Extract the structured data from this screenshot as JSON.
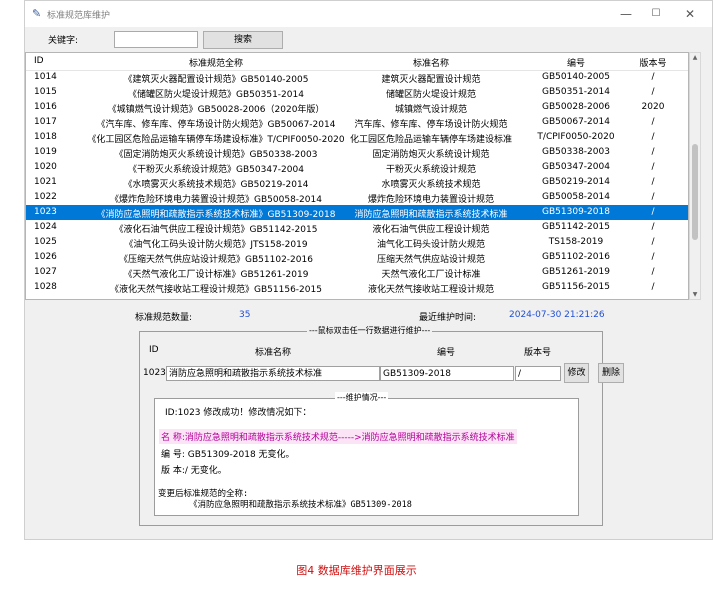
{
  "window": {
    "title": "标准规范库维护",
    "min_glyph": "—",
    "max_glyph": "☐",
    "close_glyph": "✕",
    "app_icon_glyph": "✎"
  },
  "search": {
    "label": "关键字:",
    "value": "",
    "button_label": "搜索"
  },
  "table": {
    "headers": [
      "ID",
      "标准规范全称",
      "标准名称",
      "编号",
      "版本号"
    ],
    "rows": [
      {
        "id": "1014",
        "full": "《建筑灭火器配置设计规范》GB50140-2005",
        "name": "建筑灭火器配置设计规范",
        "code": "GB50140-2005",
        "ver": "/"
      },
      {
        "id": "1015",
        "full": "《储罐区防火堤设计规范》GB50351-2014",
        "name": "储罐区防火堤设计规范",
        "code": "GB50351-2014",
        "ver": "/"
      },
      {
        "id": "1016",
        "full": "《城镇燃气设计规范》GB50028-2006（2020年版）",
        "name": "城镇燃气设计规范",
        "code": "GB50028-2006",
        "ver": "2020"
      },
      {
        "id": "1017",
        "full": "《汽车库、修车库、停车场设计防火规范》GB50067-2014",
        "name": "汽车库、修车库、停车场设计防火规范",
        "code": "GB50067-2014",
        "ver": "/"
      },
      {
        "id": "1018",
        "full": "《化工园区危险品运输车辆停车场建设标准》T/CPIF0050-2020",
        "name": "化工园区危险品运输车辆停车场建设标准",
        "code": "T/CPIF0050-2020",
        "ver": "/"
      },
      {
        "id": "1019",
        "full": "《固定消防炮灭火系统设计规范》GB50338-2003",
        "name": "固定消防炮灭火系统设计规范",
        "code": "GB50338-2003",
        "ver": "/"
      },
      {
        "id": "1020",
        "full": "《干粉灭火系统设计规范》GB50347-2004",
        "name": "干粉灭火系统设计规范",
        "code": "GB50347-2004",
        "ver": "/"
      },
      {
        "id": "1021",
        "full": "《水喷雾灭火系统技术规范》GB50219-2014",
        "name": "水喷雾灭火系统技术规范",
        "code": "GB50219-2014",
        "ver": "/"
      },
      {
        "id": "1022",
        "full": "《爆炸危险环境电力装置设计规范》GB50058-2014",
        "name": "爆炸危险环境电力装置设计规范",
        "code": "GB50058-2014",
        "ver": "/"
      },
      {
        "id": "1023",
        "full": "《消防应急照明和疏散指示系统技术标准》GB51309-2018",
        "name": "消防应急照明和疏散指示系统技术标准",
        "code": "GB51309-2018",
        "ver": "/"
      },
      {
        "id": "1024",
        "full": "《液化石油气供应工程设计规范》GB51142-2015",
        "name": "液化石油气供应工程设计规范",
        "code": "GB51142-2015",
        "ver": "/"
      },
      {
        "id": "1025",
        "full": "《油气化工码头设计防火规范》JTS158-2019",
        "name": "油气化工码头设计防火规范",
        "code": "TS158-2019",
        "ver": "/"
      },
      {
        "id": "1026",
        "full": "《压缩天然气供应站设计规范》GB51102-2016",
        "name": "压缩天然气供应站设计规范",
        "code": "GB51102-2016",
        "ver": "/"
      },
      {
        "id": "1027",
        "full": "《天然气液化工厂设计标准》GB51261-2019",
        "name": "天然气液化工厂设计标准",
        "code": "GB51261-2019",
        "ver": "/"
      },
      {
        "id": "1028",
        "full": "《液化天然气接收站工程设计规范》GB51156-2015",
        "name": "液化天然气接收站工程设计规范",
        "code": "GB51156-2015",
        "ver": "/"
      }
    ],
    "selected_id": "1023",
    "scroll_position": 0.62,
    "scroll_visible_fraction": 0.43,
    "scroll_up_glyph": "▲",
    "scroll_down_glyph": "▼"
  },
  "status": {
    "count_label": "标准规范数量:",
    "count_value": "35",
    "time_label": "最近维护时间:",
    "time_value": "2024-07-30 21:21:26"
  },
  "edit": {
    "group_title": "---鼠标双击任一行数据进行维护---",
    "headers": {
      "id": "ID",
      "name": "标准名称",
      "code": "编号",
      "ver": "版本号"
    },
    "id": "1023",
    "name": "消防应急照明和疏散指示系统技术标准",
    "code": "GB51309-2018",
    "ver": "/",
    "modify_label": "修改",
    "delete_label": "删除"
  },
  "log": {
    "group_title": "---维护情况---",
    "line1": "ID:1023  修改成功！修改情况如下：",
    "line2": "名 称:消防应急照明和疏散指示系统技术规范----->消防应急照明和疏散指示系统技术标准",
    "line3": "编 号: GB51309-2018 无变化。",
    "line4": "版 本:/ 无变化。",
    "line5": "变更后标准规范的全称:",
    "line6": "《消防应急照明和疏散指示系统技术标准》GB51309-2018"
  },
  "caption": "图4  数据库维护界面展示",
  "colors": {
    "selection": "#0078d7",
    "value_blue": "#1f4fd6",
    "log_highlight": "#b5009a",
    "caption_red": "#d01010"
  }
}
